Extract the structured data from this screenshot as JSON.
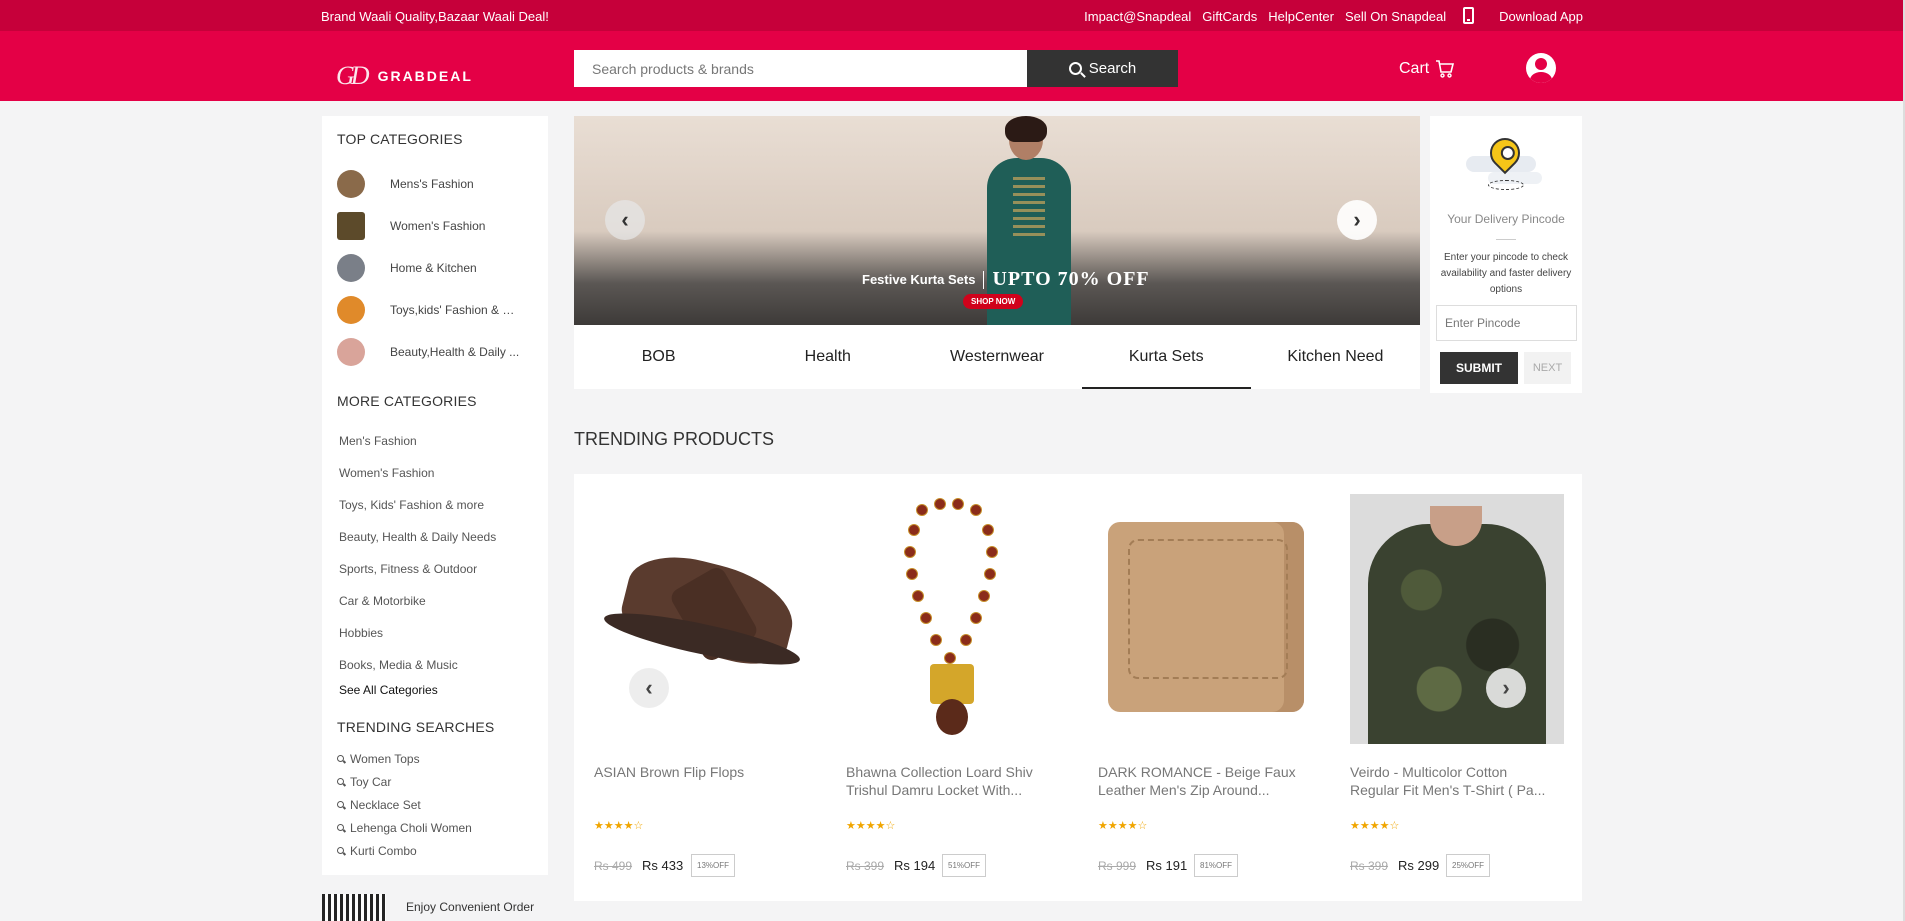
{
  "topbar": {
    "tagline": "Brand Waali Quality,Bazaar Waali Deal!",
    "links": [
      "Impact@Snapdeal",
      "GiftCards",
      "HelpCenter",
      "Sell On Snapdeal"
    ],
    "download_app": "Download App"
  },
  "header": {
    "logo_mark": "GD",
    "logo_text": "GRABDEAL",
    "search_placeholder": "Search products & brands",
    "search_button": "Search",
    "cart_label": "Cart"
  },
  "sidebar": {
    "top_categories_title": "TOP CATEGORIES",
    "top_categories": [
      {
        "label": "Mens's Fashion",
        "color": "#8a6a4a"
      },
      {
        "label": "Women's Fashion",
        "color": "#5c4a2a"
      },
      {
        "label": "Home & Kitchen",
        "color": "#7a7f88"
      },
      {
        "label": "Toys,kids' Fashion & m...",
        "color": "#e08a2a"
      },
      {
        "label": "Beauty,Health & Daily ...",
        "color": "#d9a49a"
      }
    ],
    "more_categories_title": "MORE CATEGORIES",
    "more_categories": [
      "Men's Fashion",
      "Women's Fashion",
      "Toys, Kids' Fashion & more",
      "Beauty, Health & Daily Needs",
      "Sports, Fitness & Outdoor",
      "Car & Motorbike",
      "Hobbies",
      "Books, Media & Music"
    ],
    "see_all": "See All Categories",
    "trending_title": "TRENDING SEARCHES",
    "trending_searches": [
      "Women Tops",
      "Toy Car",
      "Necklace Set",
      "Lehenga Choli Women",
      "Kurti Combo"
    ],
    "qr_text": "Enjoy Convenient Order"
  },
  "banner": {
    "caption": "Festive Kurta Sets",
    "offer": "UPTO 70% OFF",
    "cta": "SHOP NOW",
    "tabs": [
      "BOB",
      "Health",
      "Westernwear",
      "Kurta Sets",
      "Kitchen Need"
    ],
    "active_tab": "Kurta Sets"
  },
  "pincode": {
    "title": "Your Delivery Pincode",
    "description": "Enter your pincode to check availability and faster delivery options",
    "placeholder": "Enter Pincode",
    "submit": "SUBMIT",
    "next": "NEXT"
  },
  "trending": {
    "title": "TRENDING PRODUCTS",
    "products": [
      {
        "title": "ASIAN Brown Flip Flops",
        "stars": "★★★★☆",
        "old_price": "Rs 499",
        "price": "Rs 433",
        "off": "13%OFF"
      },
      {
        "title": "Bhawna Collection Loard Shiv Trishul Damru Locket With...",
        "stars": "★★★★☆",
        "old_price": "Rs 399",
        "price": "Rs 194",
        "off": "51%OFF"
      },
      {
        "title": "DARK ROMANCE - Beige Faux Leather Men's Zip Around...",
        "stars": "★★★★☆",
        "old_price": "Rs 999",
        "price": "Rs 191",
        "off": "81%OFF"
      },
      {
        "title": "Veirdo - Multicolor Cotton Regular Fit Men's T-Shirt ( Pa...",
        "stars": "★★★★☆",
        "old_price": "Rs 399",
        "price": "Rs 299",
        "off": "25%OFF"
      }
    ]
  }
}
